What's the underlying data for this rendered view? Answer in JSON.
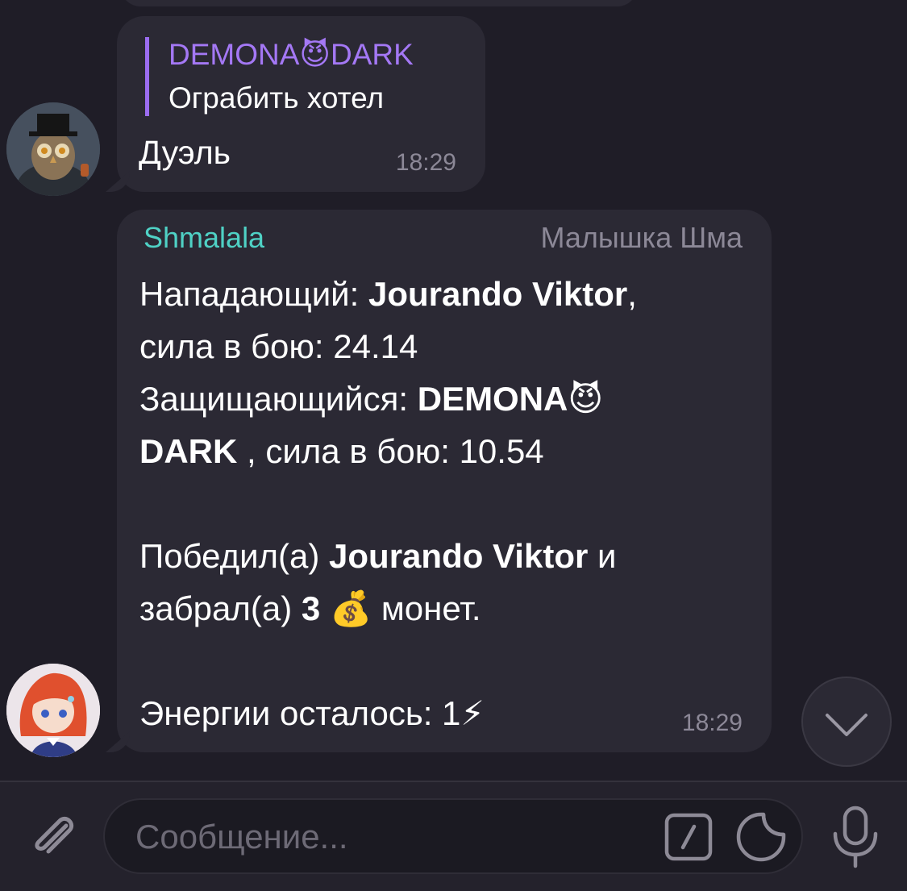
{
  "messages": [
    {
      "reply": {
        "author": "DEMONA",
        "author_emoji": "😈",
        "author_suffix": "DARK",
        "text": "Ограбить хотел"
      },
      "text": "Дуэль",
      "time": "18:29"
    },
    {
      "sender": "Shmalala",
      "rank": "Малышка Шма",
      "lines": {
        "attacker_label": "Нападающий: ",
        "attacker_name": "Jourando Viktor",
        "attacker_power": ",\nсила в бою: 24.14",
        "defender_label": "\nЗащищающийся: ",
        "defender_name": "DEMONA",
        "defender_emoji": "😈",
        "defender_suffix": "\nDARK",
        "defender_power": "  , сила в бою: 10.54",
        "winner_label": "\n\nПобедил(а) ",
        "winner_name": "Jourando Viktor",
        "winner_and": " и\nзабрал(а) ",
        "coins": "3",
        "coin_emoji": "💰",
        "coins_word": " монет.",
        "energy": "\n\nЭнергии осталось: 1",
        "energy_emoji": "⚡"
      },
      "time": "18:29"
    }
  ],
  "composer": {
    "placeholder": "Сообщение..."
  },
  "colors": {
    "background": "#1f1d27",
    "bubble": "#2b2934",
    "reply_accent": "#9b6cf0",
    "sender_name": "#4fd1c5",
    "meta": "#8c8897"
  },
  "icons": [
    "attach-icon",
    "commands-icon",
    "sticker-icon",
    "microphone-icon",
    "chevron-down-icon"
  ]
}
